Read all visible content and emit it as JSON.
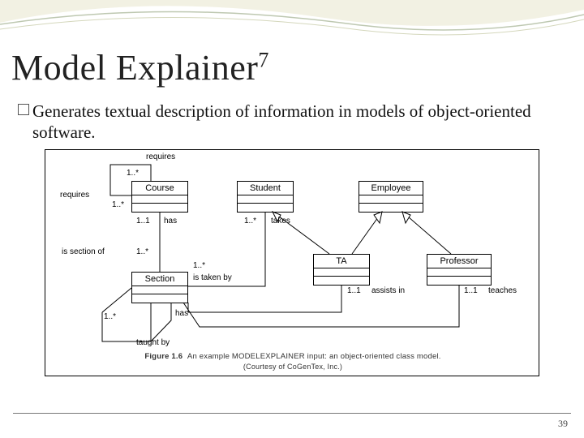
{
  "title": {
    "text": "Model Explainer",
    "sup": "7"
  },
  "bullet": "Generates textual description of information in models of object-oriented software.",
  "pageNumber": "39",
  "diagram": {
    "classes": {
      "course": {
        "name": "Course"
      },
      "student": {
        "name": "Student"
      },
      "employee": {
        "name": "Employee"
      },
      "section": {
        "name": "Section"
      },
      "ta": {
        "name": "TA"
      },
      "professor": {
        "name": "Professor"
      }
    },
    "labels": {
      "requires_top": "requires",
      "requires_left": "requires",
      "m1star_a": "1..*",
      "m1star_b": "1..*",
      "has1": "has",
      "m11_a": "1..1",
      "is_section_of": "is section of",
      "m1star_c": "1..*",
      "takes": "takes",
      "m1star_d": "1..*",
      "is_taken_by": "is taken by",
      "m1star_e": "1..*",
      "has2": "has",
      "m1star_f": "1..*",
      "taught_by": "taught by",
      "assists_in": "assists in",
      "m11_b": "1..1",
      "teaches": "teaches",
      "m11_c": "1..1"
    },
    "caption_label": "Figure 1.6",
    "caption_main": "An example MODELEXPLAINER input: an object-oriented class model.",
    "caption_sub": "(Courtesy of CoGenTex, Inc.)"
  }
}
